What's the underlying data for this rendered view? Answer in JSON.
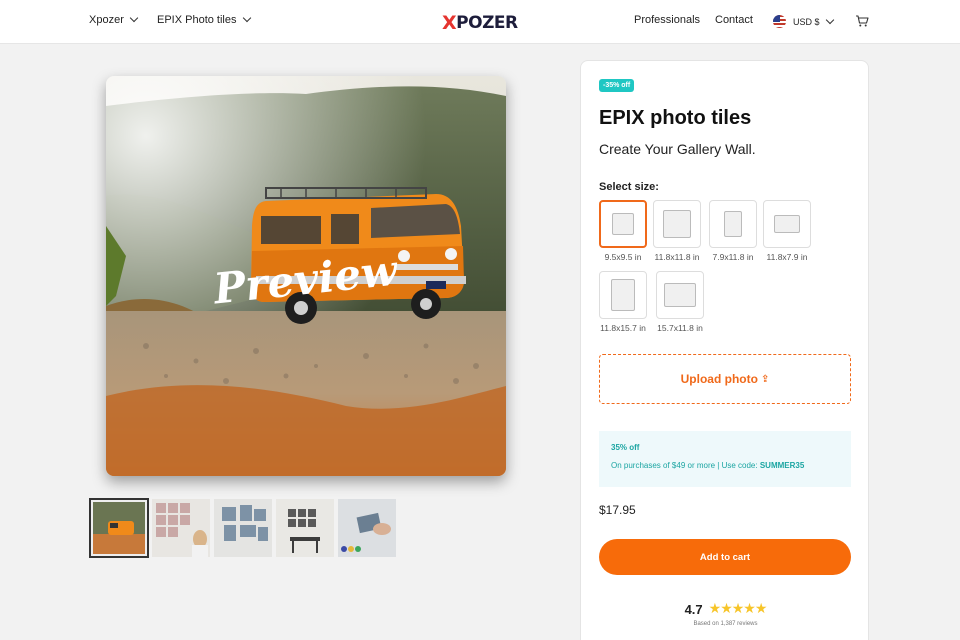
{
  "header": {
    "brand_menu": "Xpozer",
    "product_menu": "EPIX Photo tiles",
    "logo_x": "X",
    "logo_rest": "POZER",
    "professionals": "Professionals",
    "contact": "Contact",
    "currency": "USD $"
  },
  "gallery": {
    "preview_watermark": "Preview",
    "thumbnails": [
      "orange-van",
      "wall-tiles-woman",
      "gallery-wall",
      "dining-room",
      "hand-holding-tile"
    ]
  },
  "product": {
    "badge": "-35% off",
    "title": "EPIX photo tiles",
    "subtitle": "Create Your Gallery Wall.",
    "size_label": "Select size:",
    "sizes": [
      {
        "label": "9.5x9.5 in",
        "selected": true
      },
      {
        "label": "11.8x11.8 in",
        "selected": false
      },
      {
        "label": "7.9x11.8 in",
        "selected": false
      },
      {
        "label": "11.8x7.9 in",
        "selected": false
      },
      {
        "label": "11.8x15.7 in",
        "selected": false
      },
      {
        "label": "15.7x11.8 in",
        "selected": false
      }
    ],
    "upload_label": "Upload photo",
    "upload_icon": "⇪",
    "promo_title": "35% off",
    "promo_text": "On purchases of $49 or more | Use code: ",
    "promo_code": "SUMMER35",
    "price": "$17.95",
    "add_to_cart": "Add to cart",
    "rating": "4.7",
    "stars": "★★★★★",
    "reviews": "Based on 1,387 reviews"
  },
  "colors": {
    "accent": "#f76b0a",
    "badge": "#1fc7c3",
    "promo_text": "#1ba5a2",
    "star": "#f7c52a"
  }
}
